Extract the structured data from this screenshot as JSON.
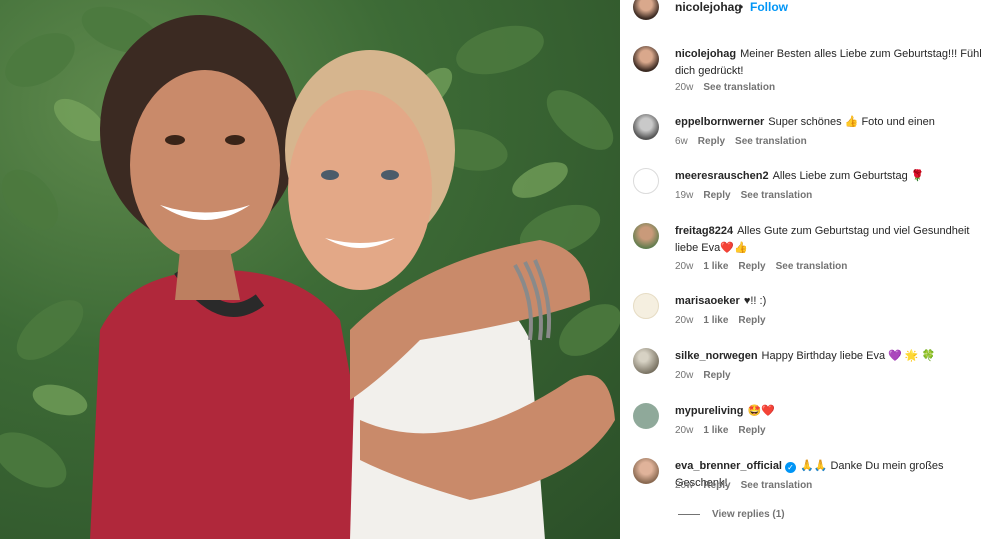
{
  "header": {
    "username": "nicolejohag",
    "separator": "•",
    "follow": "Follow"
  },
  "comments": [
    {
      "username": "nicolejohag",
      "text": "Meiner Besten alles Liebe zum Geburtstag!!! Fühl dich gedrückt!",
      "time": "20w",
      "likes": "",
      "reply": "",
      "translate": "See translation"
    },
    {
      "username": "eppelbornwerner",
      "text": "Super schönes 👍 Foto und einen",
      "time": "6w",
      "likes": "",
      "reply": "Reply",
      "translate": "See translation"
    },
    {
      "username": "meeresrauschen2",
      "text": "Alles Liebe zum Geburtstag 🌹",
      "time": "19w",
      "likes": "",
      "reply": "Reply",
      "translate": "See translation"
    },
    {
      "username": "freitag8224",
      "text": "Alles Gute zum Geburtstag und viel Gesundheit liebe Eva❤️👍",
      "time": "20w",
      "likes": "1 like",
      "reply": "Reply",
      "translate": "See translation"
    },
    {
      "username": "marisaoeker",
      "text": "♥!! :)",
      "time": "20w",
      "likes": "1 like",
      "reply": "Reply",
      "translate": ""
    },
    {
      "username": "silke_norwegen",
      "text": "Happy Birthday liebe Eva 💜 🌟 🍀",
      "time": "20w",
      "likes": "",
      "reply": "Reply",
      "translate": ""
    },
    {
      "username": "mypureliving",
      "text": "🤩❤️",
      "time": "20w",
      "likes": "1 like",
      "reply": "Reply",
      "translate": ""
    },
    {
      "username": "eva_brenner_official",
      "text": "🙏🙏 Danke Du mein großes Geschenk!",
      "time": "20w",
      "likes": "",
      "reply": "Reply",
      "translate": "See translation"
    }
  ],
  "view_replies": "View replies (1)",
  "colors": {
    "accent": "#0095f6",
    "meta": "#737373",
    "text": "#262626"
  }
}
